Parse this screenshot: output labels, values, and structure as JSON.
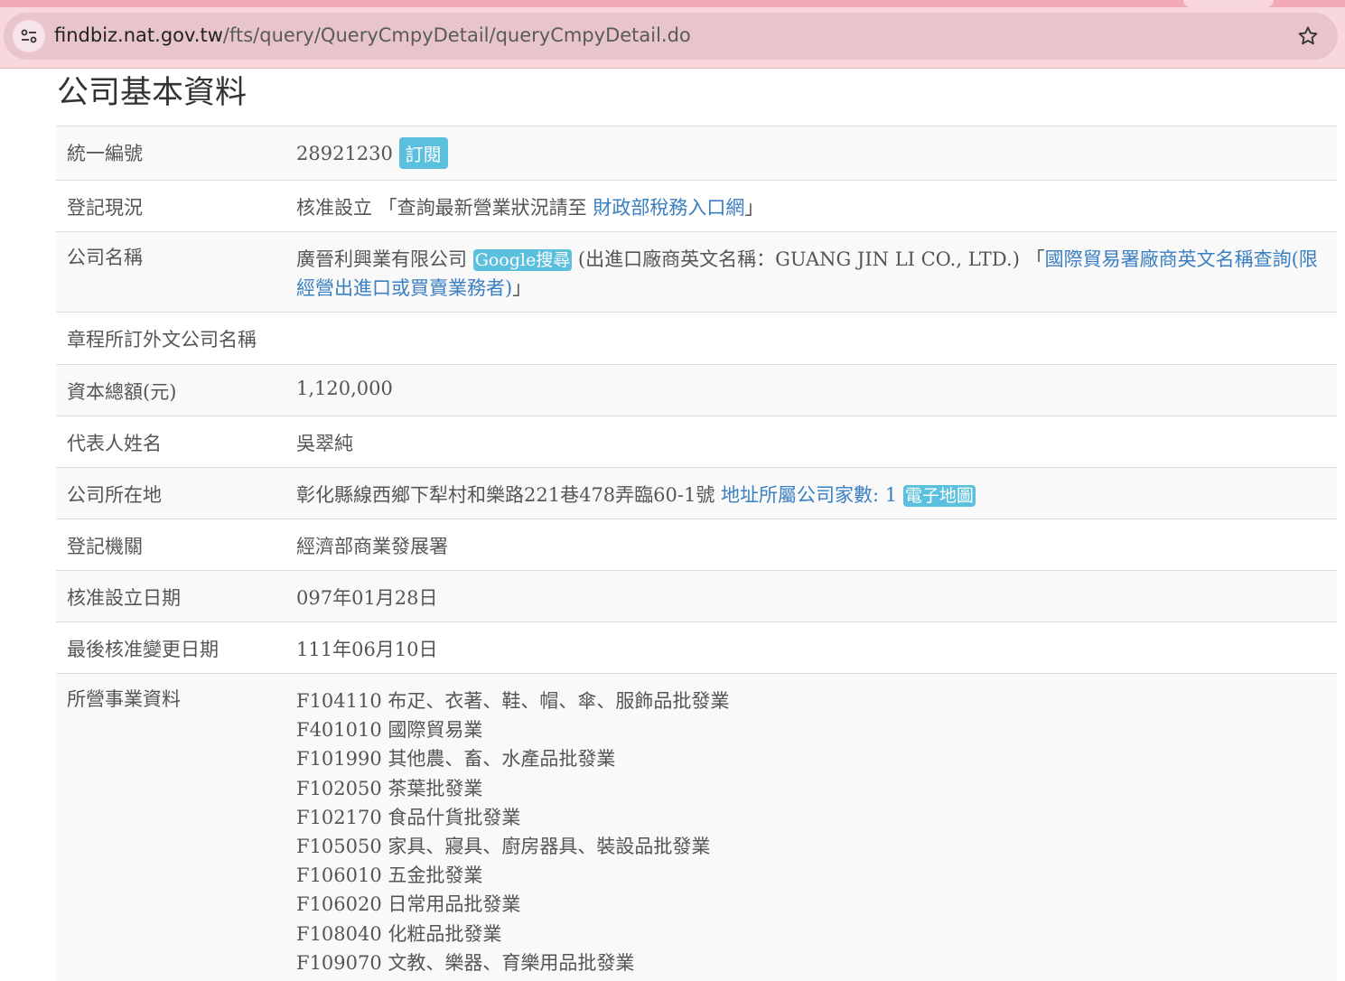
{
  "browser": {
    "url_host": "findbiz.nat.gov.tw",
    "url_path": "/fts/query/QueryCmpyDetail/queryCmpyDetail.do",
    "site_info_icon": "tune-icon",
    "bookmark_icon": "star-icon"
  },
  "page": {
    "title": "公司基本資料"
  },
  "rows": {
    "ubn": {
      "label": "統一編號",
      "value": "28921230",
      "subscribe": "訂閱"
    },
    "status": {
      "label": "登記現況",
      "prefix": "核准設立 「查詢最新營業狀況請至 ",
      "link": "財政部稅務入口網",
      "suffix": "」"
    },
    "name": {
      "label": "公司名稱",
      "value": "廣晉利興業有限公司",
      "google": "Google搜尋",
      "english_note": "(出進口廠商英文名稱：GUANG JIN LI CO., LTD.) 「",
      "trade_link": "國際貿易署廠商英文名稱查詢(限經營出進口或買賣業務者)",
      "trade_suffix": "」"
    },
    "foreign_name": {
      "label": "章程所訂外文公司名稱",
      "value": ""
    },
    "capital": {
      "label": "資本總額(元)",
      "value": "1,120,000"
    },
    "representative": {
      "label": "代表人姓名",
      "value": "吳翠純"
    },
    "address": {
      "label": "公司所在地",
      "value": "彰化縣線西鄉下犁村和樂路221巷478弄臨60-1號 ",
      "count_link": "地址所屬公司家數: 1",
      "map": "電子地圖"
    },
    "authority": {
      "label": "登記機關",
      "value": "經濟部商業發展署"
    },
    "approval_date": {
      "label": "核准設立日期",
      "value": "097年01月28日"
    },
    "change_date": {
      "label": "最後核准變更日期",
      "value": "111年06月10日"
    },
    "business": {
      "label": "所營事業資料",
      "items": [
        "F104110 布疋、衣著、鞋、帽、傘、服飾品批發業",
        "F401010 國際貿易業",
        "F101990 其他農、畜、水產品批發業",
        "F102050 茶葉批發業",
        "F102170 食品什貨批發業",
        "F105050 家具、寢具、廚房器具、裝設品批發業",
        "F106010 五金批發業",
        "F106020 日常用品批發業",
        "F108040 化粧品批發業",
        "F109070 文教、樂器、育樂用品批發業"
      ]
    }
  }
}
